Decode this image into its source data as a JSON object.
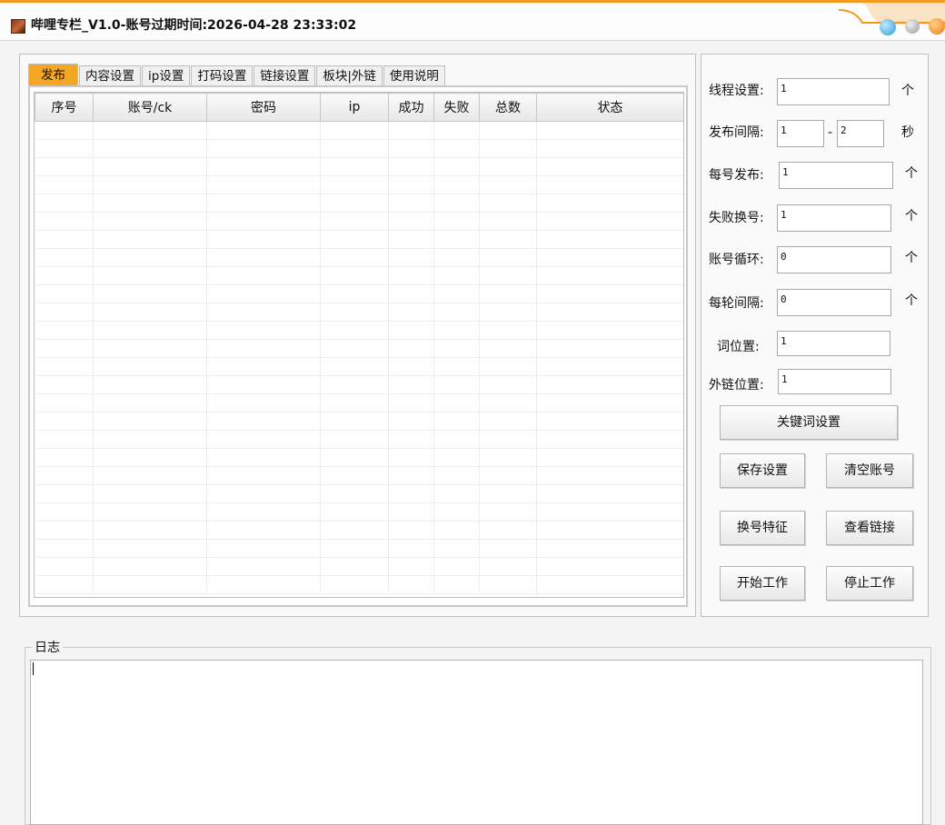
{
  "window": {
    "title": "哔哩专栏_V1.0-账号过期时间:2026-04-28 23:33:02",
    "icon": "app-logo-icon",
    "controls": [
      "minimize-icon",
      "maximize-icon",
      "close-icon"
    ],
    "accent_color": "#f29a1e"
  },
  "tabs": [
    {
      "label": "发布",
      "active": true
    },
    {
      "label": "内容设置",
      "active": false
    },
    {
      "label": "ip设置",
      "active": false
    },
    {
      "label": "打码设置",
      "active": false
    },
    {
      "label": "链接设置",
      "active": false
    },
    {
      "label": "板块|外链",
      "active": false
    },
    {
      "label": "使用说明",
      "active": false
    }
  ],
  "table": {
    "columns": [
      "序号",
      "账号/ck",
      "密码",
      "ip",
      "成功",
      "失败",
      "总数",
      "状态"
    ],
    "rows": []
  },
  "settings": {
    "threads": {
      "label": "线程设置:",
      "value": "1",
      "unit": "个"
    },
    "interval": {
      "label": "发布间隔:",
      "from": "1",
      "sep": "-",
      "to": "2",
      "unit": "秒"
    },
    "per_account": {
      "label": "每号发布:",
      "value": "1",
      "unit": "个"
    },
    "fail_switch": {
      "label": "失败换号:",
      "value": "1",
      "unit": "个"
    },
    "account_loop": {
      "label": "账号循环:",
      "value": "0",
      "unit": "个"
    },
    "round_interval": {
      "label": "每轮间隔:",
      "value": "0",
      "unit": "个"
    },
    "word_position": {
      "label": "词位置:",
      "value": "1"
    },
    "link_position": {
      "label": "外链位置:",
      "value": "1"
    }
  },
  "buttons": {
    "keyword_settings": "关键词设置",
    "save_settings": "保存设置",
    "clear_accounts": "清空账号",
    "switch_feature": "换号特征",
    "view_links": "查看链接",
    "start_work": "开始工作",
    "stop_work": "停止工作"
  },
  "log": {
    "legend": "日志",
    "content": ""
  }
}
